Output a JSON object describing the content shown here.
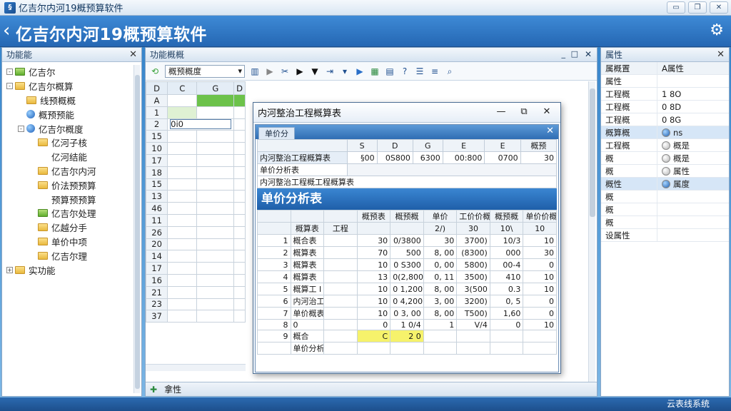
{
  "window": {
    "title": "亿吉尔内河19概预算软件",
    "controls": [
      "▭",
      "❐",
      "✕"
    ]
  },
  "banner": {
    "title": "亿吉尔内河19概预算软件"
  },
  "left_panel": {
    "title": "功能能",
    "close": "✕",
    "tree": [
      {
        "label": "亿吉尔",
        "indent": 0,
        "toggle": "-",
        "icon": "folder-green"
      },
      {
        "label": "亿吉尔概算",
        "indent": 0,
        "toggle": "-",
        "icon": "folder"
      },
      {
        "label": "线预概概",
        "indent": 1,
        "toggle": "",
        "icon": "folder"
      },
      {
        "label": "概预预能",
        "indent": 1,
        "toggle": "",
        "icon": "ball"
      },
      {
        "label": "亿吉尔概度",
        "indent": 1,
        "toggle": "-",
        "icon": "ball"
      },
      {
        "label": "亿河子核",
        "indent": 2,
        "toggle": "",
        "icon": "folder"
      },
      {
        "label": "亿河结能",
        "indent": 2,
        "toggle": "",
        "icon": "none"
      },
      {
        "label": "亿吉尔内河",
        "indent": 2,
        "toggle": "",
        "icon": "folder"
      },
      {
        "label": "价法预预算",
        "indent": 2,
        "toggle": "",
        "icon": "folder"
      },
      {
        "label": "预算预预算",
        "indent": 2,
        "toggle": "",
        "icon": "none"
      },
      {
        "label": "亿吉尔处理",
        "indent": 2,
        "toggle": "",
        "icon": "folder-green"
      },
      {
        "label": "亿越分手",
        "indent": 2,
        "toggle": "",
        "icon": "folder"
      },
      {
        "label": "单价中项",
        "indent": 2,
        "toggle": "",
        "icon": "folder"
      },
      {
        "label": "亿吉尔理",
        "indent": 2,
        "toggle": "",
        "icon": "folder"
      },
      {
        "label": "实功能",
        "indent": 0,
        "toggle": "+",
        "icon": "folder"
      }
    ]
  },
  "center_panel": {
    "title": "功能概概",
    "controls": [
      "_",
      "□",
      "✕"
    ],
    "toolbar_combo": "概预概度",
    "sheet": {
      "col_headers": [
        "D",
        "C",
        "G",
        "D"
      ],
      "rows": [
        "A",
        "1",
        "2",
        "15",
        "10",
        "17",
        "18",
        "15",
        "13",
        "46",
        "11",
        "26",
        "20",
        "14",
        "17",
        "16",
        "21",
        "23",
        "37"
      ],
      "row2_value": "0i0"
    },
    "bottom_tab": "拿性"
  },
  "dialog": {
    "title": "内河整治工程概算表",
    "buttons": [
      "—",
      "⧉",
      "✕"
    ],
    "inner_tab": "单价分",
    "t1_headers": [
      "",
      "S",
      "D",
      "G",
      "E",
      "E",
      "概预"
    ],
    "t1_row1": [
      "内河整治工程概算表",
      "§00",
      "0S800",
      "6300",
      "00:800",
      "0700",
      "30"
    ],
    "t1_row2": "单价分析表",
    "t1_row3": "内河整治工程概工程概算表",
    "section_title": "单价分析表",
    "t2_headers": [
      "",
      "概预表",
      "概预概",
      "单价",
      "工价价概概",
      "概预概",
      "单价价概"
    ],
    "t2_headers_r2": [
      "",
      "",
      "",
      "2/)",
      "30",
      "10\\",
      "10"
    ],
    "t2_rows": [
      [
        "1",
        "概合表",
        "",
        "30",
        "0/3800",
        "30",
        "3700)",
        "10/3",
        "10"
      ],
      [
        "2",
        "概算表",
        "",
        "70",
        "500",
        "8, 00",
        "(8300)",
        "000",
        "30"
      ],
      [
        "3",
        "概算表",
        "",
        "10",
        "0 S300",
        "0, 00",
        "5800)",
        "00-4",
        "0"
      ],
      [
        "4",
        "概算表",
        "",
        "13",
        "0(2,800",
        "0, 11",
        "3500)",
        "410",
        "10"
      ],
      [
        "5",
        "概算工 I",
        "",
        "10",
        "0 1,200",
        "8, 00",
        "3(500",
        "0.3",
        "10"
      ],
      [
        "6",
        "内河治工程概算",
        "",
        "10",
        "0 4,200",
        "3, 00",
        "3200)",
        "0, 5",
        "0"
      ],
      [
        "7",
        "单价概表",
        "",
        "10",
        "0 3, 00",
        "8, 00",
        "T500)",
        "1,60",
        "0"
      ],
      [
        "8",
        "0",
        "",
        "0",
        "1 0/4",
        "1",
        "V/4",
        "0",
        "10"
      ],
      [
        "9",
        "概合",
        "",
        "C",
        "2 0",
        "",
        "",
        "",
        ""
      ],
      [
        "",
        "单价分析",
        "",
        "",
        "",
        "",
        "",
        "",
        ""
      ]
    ]
  },
  "right_panel": {
    "title": "属性",
    "close": "✕",
    "props": [
      {
        "k": "属概置",
        "v": "A属性",
        "type": "head"
      },
      {
        "k": "属性",
        "v": "",
        "type": "text"
      },
      {
        "k": "工程概",
        "v": "1 8O",
        "type": "text"
      },
      {
        "k": "工程概",
        "v": "0 8D",
        "type": "text"
      },
      {
        "k": "工程概",
        "v": "0 8G",
        "type": "text"
      },
      {
        "k": "概算概",
        "v": "ns",
        "type": "dot-blue",
        "sel": true
      },
      {
        "k": "工程概",
        "v": "概是",
        "type": "dot-gray"
      },
      {
        "k": "  概",
        "v": "概是",
        "type": "dot-gray-small"
      },
      {
        "k": "  概",
        "v": "属性",
        "type": "dot-gray-small"
      },
      {
        "k": "概性",
        "v": "属度",
        "type": "dot-blue",
        "sel": true
      },
      {
        "k": "  概",
        "v": "",
        "type": "text"
      },
      {
        "k": "  概",
        "v": "",
        "type": "text"
      },
      {
        "k": "  概",
        "v": "",
        "type": "text"
      },
      {
        "k": "设属性",
        "v": "",
        "type": "text"
      }
    ]
  },
  "status": {
    "text": "云表线系统"
  }
}
